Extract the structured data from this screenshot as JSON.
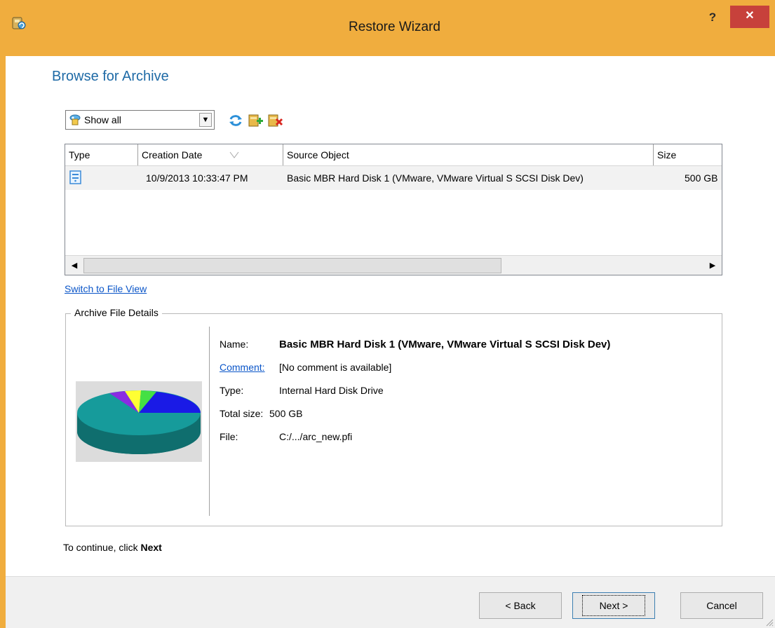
{
  "window": {
    "title": "Restore Wizard",
    "help_label": "?",
    "close_label": "✕",
    "frame_color": "#f0ad3e",
    "close_color": "#c7413b"
  },
  "page": {
    "heading": "Browse for Archive",
    "heading_color": "#1e6aa6"
  },
  "toolbar": {
    "filter_value": "Show all",
    "icons": [
      "refresh-icon",
      "add-archive-icon",
      "delete-archive-icon"
    ]
  },
  "archive_list": {
    "columns": [
      "Type",
      "Creation Date",
      "Source Object",
      "Size"
    ],
    "rows": [
      {
        "type_icon": "disk-image-icon",
        "creation_date": "10/9/2013 10:33:47 PM",
        "source_object": "Basic MBR Hard Disk 1 (VMware, VMware Virtual S SCSI Disk Dev)",
        "size": "500 GB"
      }
    ]
  },
  "switch_view_link": "Switch to File View",
  "details": {
    "group_title": "Archive File Details",
    "name_label": "Name:",
    "name_value": "Basic MBR Hard Disk 1 (VMware, VMware Virtual S SCSI Disk Dev)",
    "comment_label": "Comment:",
    "comment_value": "[No comment is available]",
    "type_label": "Type:",
    "type_value": "Internal Hard Disk Drive",
    "total_size_label": "Total size:",
    "total_size_value": "500 GB",
    "file_label": "File:",
    "file_value": "C:/.../arc_new.pfi",
    "pie_icon": "disk-usage-pie-icon"
  },
  "instruction": {
    "prefix": "To continue, click ",
    "emphasis": "Next"
  },
  "buttons": {
    "back": "< Back",
    "next": "Next >",
    "cancel": "Cancel"
  }
}
